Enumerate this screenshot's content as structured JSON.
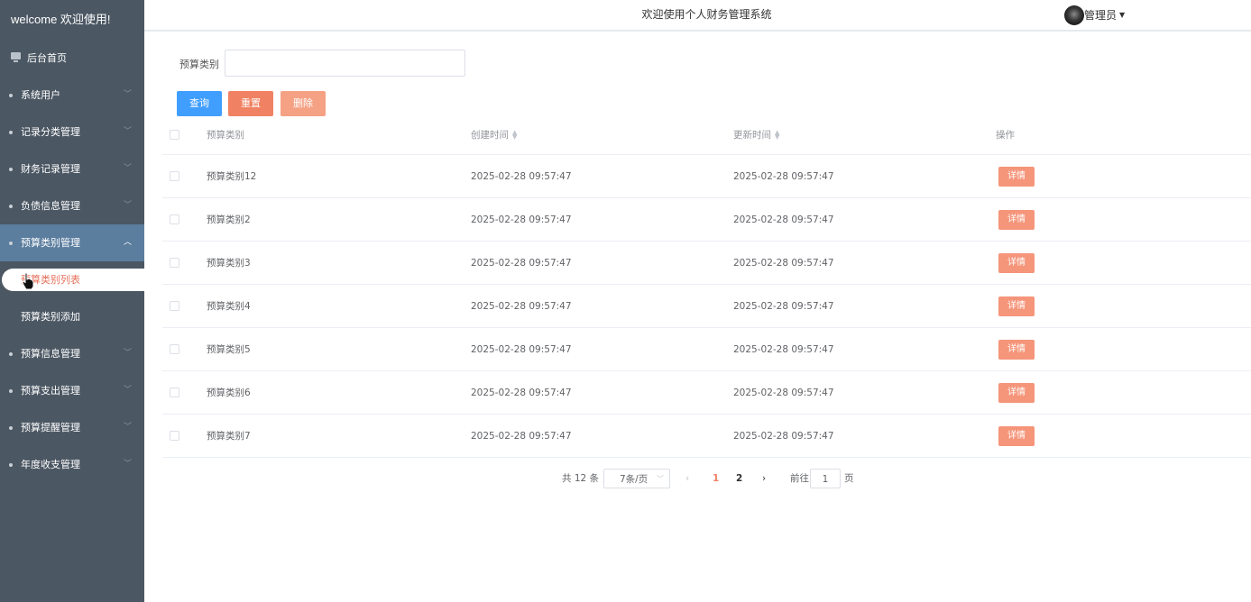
{
  "sidebar": {
    "title": "welcome 欢迎使用!",
    "home": "后台首页",
    "menu": [
      {
        "label": "系统用户"
      },
      {
        "label": "记录分类管理"
      },
      {
        "label": "财务记录管理"
      },
      {
        "label": "负债信息管理"
      },
      {
        "label": "预算类别管理"
      }
    ],
    "submenu": [
      {
        "label": "预算类别列表"
      },
      {
        "label": "预算类别添加"
      }
    ],
    "menu_after": [
      {
        "label": "预算信息管理"
      },
      {
        "label": "预算支出管理"
      },
      {
        "label": "预算提醒管理"
      },
      {
        "label": "年度收支管理"
      }
    ]
  },
  "header": {
    "title": "欢迎使用个人财务管理系统",
    "user": "管理员"
  },
  "search": {
    "label": "预算类别",
    "value": ""
  },
  "buttons": {
    "query": "查询",
    "reset": "重置",
    "delete": "删除"
  },
  "table": {
    "headers": [
      "预算类别",
      "创建时间",
      "更新时间",
      "操作"
    ],
    "rows": [
      {
        "name": "预算类别12",
        "created": "2025-02-28 09:57:47",
        "updated": "2025-02-28 09:57:47",
        "action": "详情"
      },
      {
        "name": "预算类别2",
        "created": "2025-02-28 09:57:47",
        "updated": "2025-02-28 09:57:47",
        "action": "详情"
      },
      {
        "name": "预算类别3",
        "created": "2025-02-28 09:57:47",
        "updated": "2025-02-28 09:57:47",
        "action": "详情"
      },
      {
        "name": "预算类别4",
        "created": "2025-02-28 09:57:47",
        "updated": "2025-02-28 09:57:47",
        "action": "详情"
      },
      {
        "name": "预算类别5",
        "created": "2025-02-28 09:57:47",
        "updated": "2025-02-28 09:57:47",
        "action": "详情"
      },
      {
        "name": "预算类别6",
        "created": "2025-02-28 09:57:47",
        "updated": "2025-02-28 09:57:47",
        "action": "详情"
      },
      {
        "name": "预算类别7",
        "created": "2025-02-28 09:57:47",
        "updated": "2025-02-28 09:57:47",
        "action": "详情"
      }
    ]
  },
  "pagination": {
    "total": "共 12 条",
    "page_size": "7条/页",
    "pages": [
      "1",
      "2"
    ],
    "current": "1",
    "goto_label": "前往",
    "goto_value": "1",
    "page_suffix": "页"
  },
  "colors": {
    "sidebar_bg": "#4b5763",
    "sidebar_active": "#5b7d9e",
    "primary": "#409eff",
    "accent": "#f08263"
  }
}
